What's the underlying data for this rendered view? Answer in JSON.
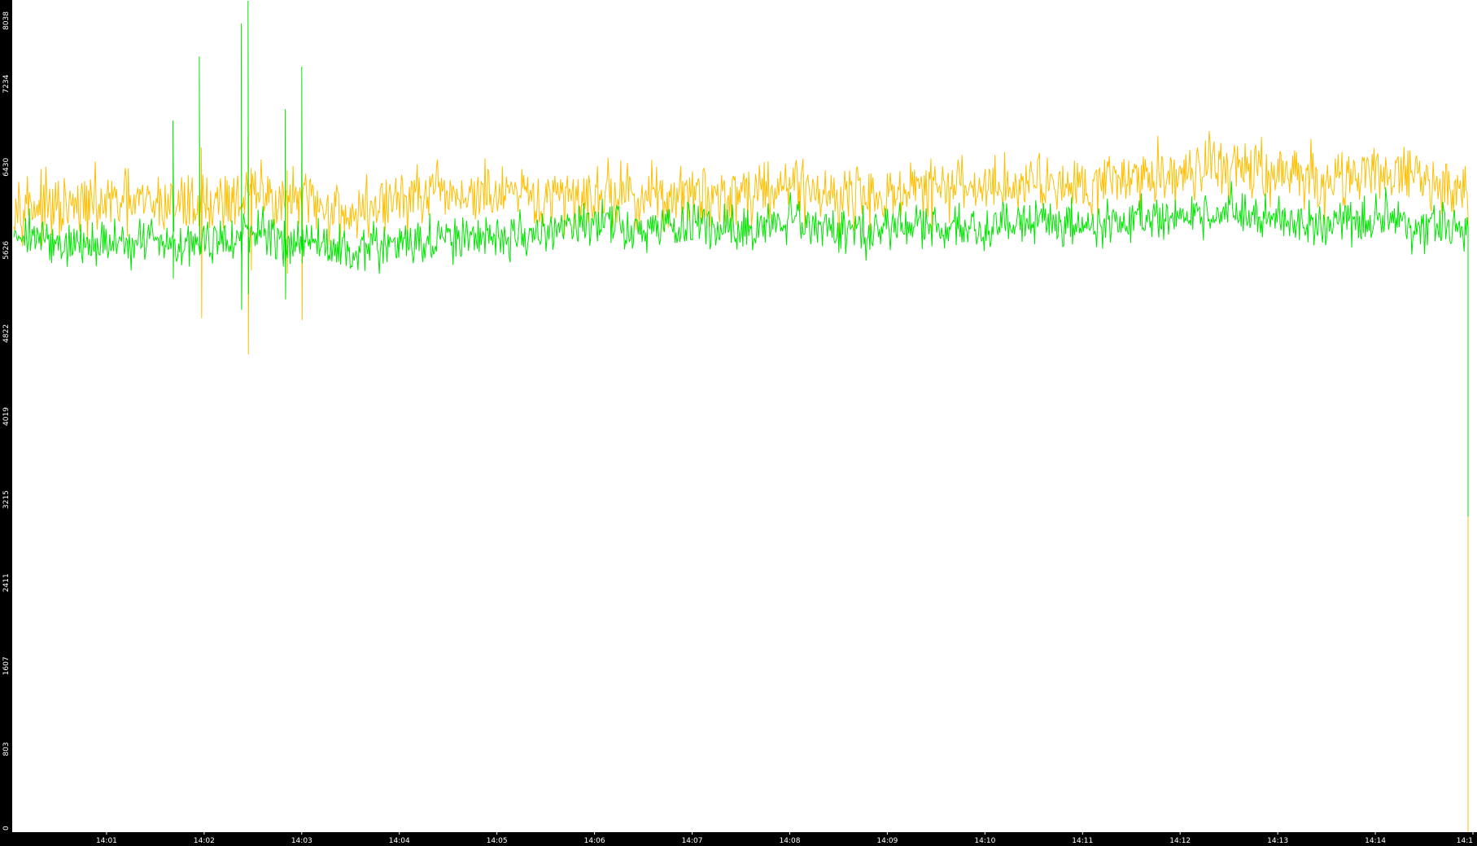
{
  "chart_data": {
    "type": "line",
    "title": "",
    "xlabel": "",
    "ylabel": "",
    "ylim": [
      0,
      8038
    ],
    "grid": false,
    "legend": "none",
    "background_color": "#000000",
    "plot_background_color": "#ffffff",
    "axis_text_color": "#ffffff",
    "y_ticks": [
      0,
      803,
      1607,
      2411,
      3215,
      4019,
      4822,
      5626,
      6430,
      7234,
      8038
    ],
    "x_ticks": [
      {
        "label": "14:01",
        "minute": 1
      },
      {
        "label": "14:02",
        "minute": 2
      },
      {
        "label": "14:03",
        "minute": 3
      },
      {
        "label": "14:04",
        "minute": 4
      },
      {
        "label": "14:05",
        "minute": 5
      },
      {
        "label": "14:06",
        "minute": 6
      },
      {
        "label": "14:07",
        "minute": 7
      },
      {
        "label": "14:08",
        "minute": 8
      },
      {
        "label": "14:09",
        "minute": 9
      },
      {
        "label": "14:10",
        "minute": 10
      },
      {
        "label": "14:11",
        "minute": 11
      },
      {
        "label": "14:12",
        "minute": 12
      },
      {
        "label": "14:13",
        "minute": 13
      },
      {
        "label": "14:14",
        "minute": 14
      },
      {
        "label": "14:1",
        "minute": 15
      }
    ],
    "x_range_minutes": [
      0.05,
      15.0
    ],
    "series": [
      {
        "color": "#ffbf00",
        "x": [
          0.05,
          0.5,
          1.0,
          1.5,
          2.0,
          2.5,
          3.0,
          3.5,
          4.0,
          4.5,
          5.0,
          5.5,
          6.0,
          6.5,
          7.0,
          7.5,
          8.0,
          8.5,
          9.0,
          9.5,
          10.0,
          10.5,
          11.0,
          11.5,
          12.0,
          12.5,
          13.0,
          13.5,
          14.0,
          14.5,
          14.95
        ],
        "values": [
          6130,
          6000,
          6080,
          6070,
          6080,
          6170,
          6100,
          5970,
          6120,
          6160,
          6150,
          6100,
          6180,
          6150,
          6140,
          6180,
          6280,
          6150,
          6160,
          6220,
          6240,
          6290,
          6290,
          6330,
          6380,
          6440,
          6370,
          6280,
          6400,
          6290,
          6200
        ],
        "noise": 150,
        "spikes": [
          {
            "x": 1.97,
            "lo": 4970,
            "hi": 6620
          },
          {
            "x": 2.45,
            "lo": 4620,
            "hi": 6730
          },
          {
            "x": 2.48,
            "lo": 5430,
            "hi": 6420
          },
          {
            "x": 2.85,
            "lo": 5400,
            "hi": 6400
          },
          {
            "x": 3.0,
            "lo": 4950,
            "hi": 6480
          }
        ],
        "end_drop_to": 0
      },
      {
        "color": "#00e600",
        "x": [
          0.05,
          0.5,
          1.0,
          1.5,
          2.0,
          2.5,
          3.0,
          3.5,
          4.0,
          4.5,
          5.0,
          5.5,
          6.0,
          6.5,
          7.0,
          7.5,
          8.0,
          8.5,
          9.0,
          9.5,
          10.0,
          10.5,
          11.0,
          11.5,
          12.0,
          12.5,
          13.0,
          13.5,
          14.0,
          14.5,
          14.95
        ],
        "values": [
          5830,
          5680,
          5690,
          5730,
          5700,
          5760,
          5720,
          5620,
          5700,
          5720,
          5760,
          5800,
          5880,
          5830,
          5870,
          5800,
          5900,
          5820,
          5870,
          5820,
          5850,
          5920,
          5880,
          5910,
          5960,
          6020,
          5910,
          5850,
          5950,
          5840,
          5850
        ],
        "noise": 110,
        "spikes": [
          {
            "x": 1.68,
            "lo": 5350,
            "hi": 6880
          },
          {
            "x": 1.95,
            "lo": 5700,
            "hi": 7500
          },
          {
            "x": 2.38,
            "lo": 5050,
            "hi": 7820
          },
          {
            "x": 2.45,
            "lo": 5200,
            "hi": 8038
          },
          {
            "x": 2.83,
            "lo": 5150,
            "hi": 6990
          },
          {
            "x": 3.0,
            "lo": 5500,
            "hi": 7400
          }
        ],
        "end_drop_to": 3050
      }
    ]
  }
}
